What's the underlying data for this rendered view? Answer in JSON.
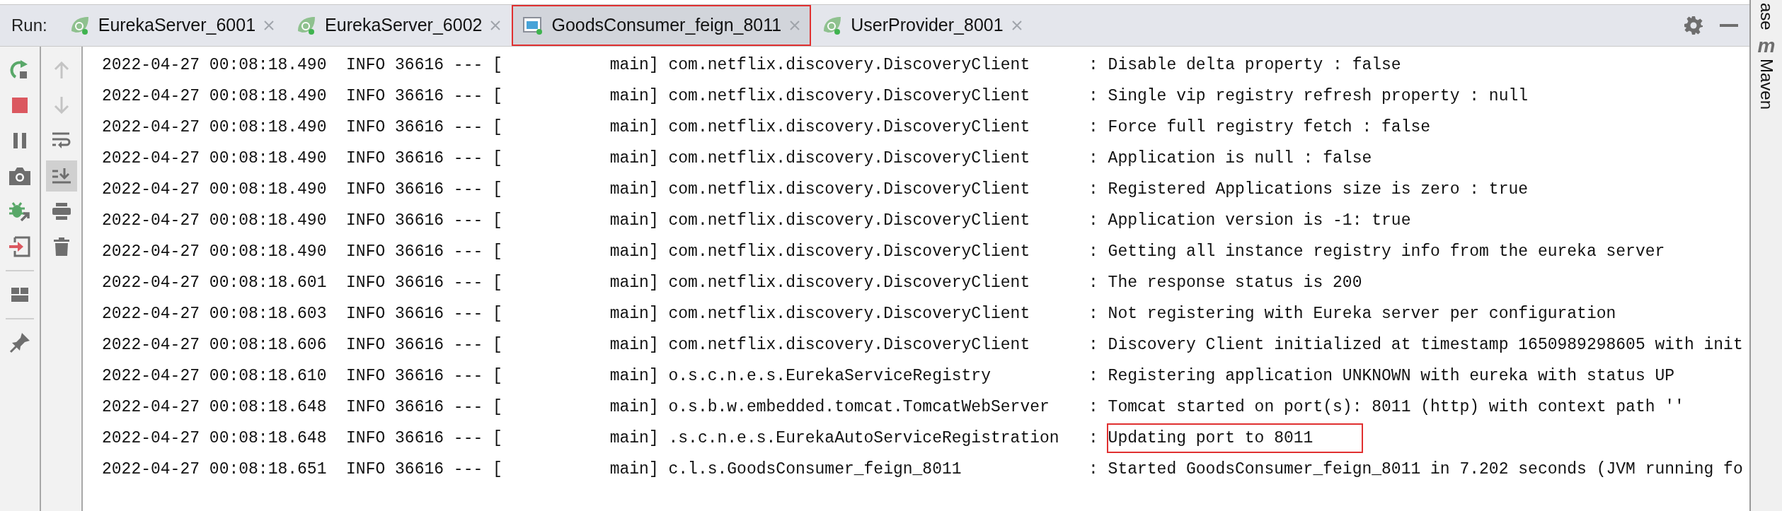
{
  "run_label": "Run:",
  "tabs": [
    {
      "label": "EurekaServer_6001",
      "kind": "spring",
      "selected": false,
      "highlighted": false
    },
    {
      "label": "EurekaServer_6002",
      "kind": "spring",
      "selected": false,
      "highlighted": false
    },
    {
      "label": "GoodsConsumer_feign_8011",
      "kind": "app",
      "selected": true,
      "highlighted": true
    },
    {
      "label": "UserProvider_8001",
      "kind": "spring",
      "selected": false,
      "highlighted": false
    }
  ],
  "toolbar_main": [
    {
      "kind": "rerun"
    },
    {
      "kind": "stop"
    },
    {
      "kind": "pause"
    },
    {
      "kind": "camera"
    },
    {
      "kind": "debug"
    },
    {
      "kind": "exit"
    },
    {
      "kind": "separator"
    },
    {
      "kind": "layout"
    },
    {
      "kind": "separator"
    },
    {
      "kind": "pin"
    }
  ],
  "toolbar_console": [
    {
      "kind": "up",
      "disabled": true,
      "selected": false
    },
    {
      "kind": "down",
      "disabled": true,
      "selected": false
    },
    {
      "kind": "wrap",
      "disabled": false,
      "selected": false
    },
    {
      "kind": "scroll-end",
      "disabled": false,
      "selected": true
    },
    {
      "kind": "print",
      "disabled": false,
      "selected": false
    },
    {
      "kind": "trash",
      "disabled": false,
      "selected": false
    }
  ],
  "log": [
    {
      "time": "2022-04-27 00:08:18.490",
      "level": "INFO",
      "pid": "36616",
      "sep": "---",
      "thread": "[           main]",
      "logger": "com.netflix.discovery.DiscoveryClient",
      "colon": ":",
      "message": "Disable delta property : false",
      "highlighted": false
    },
    {
      "time": "2022-04-27 00:08:18.490",
      "level": "INFO",
      "pid": "36616",
      "sep": "---",
      "thread": "[           main]",
      "logger": "com.netflix.discovery.DiscoveryClient",
      "colon": ":",
      "message": "Single vip registry refresh property : null",
      "highlighted": false
    },
    {
      "time": "2022-04-27 00:08:18.490",
      "level": "INFO",
      "pid": "36616",
      "sep": "---",
      "thread": "[           main]",
      "logger": "com.netflix.discovery.DiscoveryClient",
      "colon": ":",
      "message": "Force full registry fetch : false",
      "highlighted": false
    },
    {
      "time": "2022-04-27 00:08:18.490",
      "level": "INFO",
      "pid": "36616",
      "sep": "---",
      "thread": "[           main]",
      "logger": "com.netflix.discovery.DiscoveryClient",
      "colon": ":",
      "message": "Application is null : false",
      "highlighted": false
    },
    {
      "time": "2022-04-27 00:08:18.490",
      "level": "INFO",
      "pid": "36616",
      "sep": "---",
      "thread": "[           main]",
      "logger": "com.netflix.discovery.DiscoveryClient",
      "colon": ":",
      "message": "Registered Applications size is zero : true",
      "highlighted": false
    },
    {
      "time": "2022-04-27 00:08:18.490",
      "level": "INFO",
      "pid": "36616",
      "sep": "---",
      "thread": "[           main]",
      "logger": "com.netflix.discovery.DiscoveryClient",
      "colon": ":",
      "message": "Application version is -1: true",
      "highlighted": false
    },
    {
      "time": "2022-04-27 00:08:18.490",
      "level": "INFO",
      "pid": "36616",
      "sep": "---",
      "thread": "[           main]",
      "logger": "com.netflix.discovery.DiscoveryClient",
      "colon": ":",
      "message": "Getting all instance registry info from the eureka server",
      "highlighted": false
    },
    {
      "time": "2022-04-27 00:08:18.601",
      "level": "INFO",
      "pid": "36616",
      "sep": "---",
      "thread": "[           main]",
      "logger": "com.netflix.discovery.DiscoveryClient",
      "colon": ":",
      "message": "The response status is 200",
      "highlighted": false
    },
    {
      "time": "2022-04-27 00:08:18.603",
      "level": "INFO",
      "pid": "36616",
      "sep": "---",
      "thread": "[           main]",
      "logger": "com.netflix.discovery.DiscoveryClient",
      "colon": ":",
      "message": "Not registering with Eureka server per configuration",
      "highlighted": false
    },
    {
      "time": "2022-04-27 00:08:18.606",
      "level": "INFO",
      "pid": "36616",
      "sep": "---",
      "thread": "[           main]",
      "logger": "com.netflix.discovery.DiscoveryClient",
      "colon": ":",
      "message": "Discovery Client initialized at timestamp 1650989298605 with init",
      "highlighted": false
    },
    {
      "time": "2022-04-27 00:08:18.610",
      "level": "INFO",
      "pid": "36616",
      "sep": "---",
      "thread": "[           main]",
      "logger": "o.s.c.n.e.s.EurekaServiceRegistry",
      "colon": ":",
      "message": "Registering application UNKNOWN with eureka with status UP",
      "highlighted": false
    },
    {
      "time": "2022-04-27 00:08:18.648",
      "level": "INFO",
      "pid": "36616",
      "sep": "---",
      "thread": "[           main]",
      "logger": "o.s.b.w.embedded.tomcat.TomcatWebServer",
      "colon": ":",
      "message": "Tomcat started on port(s): 8011 (http) with context path ''",
      "highlighted": false
    },
    {
      "time": "2022-04-27 00:08:18.648",
      "level": "INFO",
      "pid": "36616",
      "sep": "---",
      "thread": "[           main]",
      "logger": ".s.c.n.e.s.EurekaAutoServiceRegistration",
      "colon": ":",
      "message": "Updating port to 8011",
      "highlighted": true
    },
    {
      "time": "2022-04-27 00:08:18.651",
      "level": "INFO",
      "pid": "36616",
      "sep": "---",
      "thread": "[           main]",
      "logger": "c.l.s.GoodsConsumer_feign_8011",
      "colon": ":",
      "message": "Started GoodsConsumer_feign_8011 in 7.202 seconds (JVM running fo",
      "highlighted": false
    }
  ],
  "side_tools": [
    {
      "label": "ase",
      "kind": "plain"
    },
    {
      "label": "Maven",
      "kind": "maven",
      "glyph": "m"
    }
  ]
}
